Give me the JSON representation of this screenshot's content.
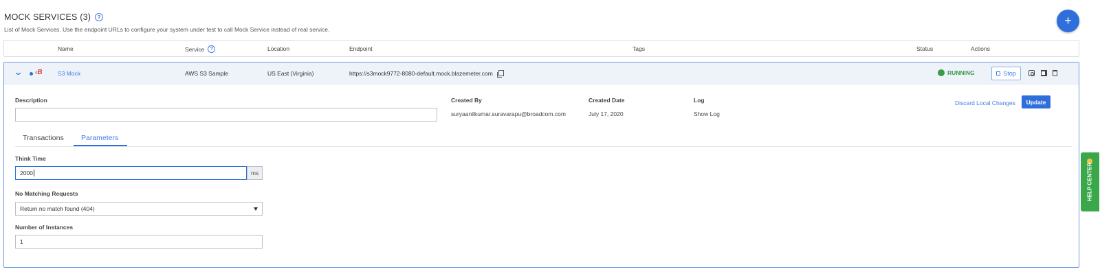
{
  "page": {
    "title": "MOCK SERVICES (3)",
    "subtitle": "List of Mock Services. Use the endpoint URLs to configure your system under test to call Mock Service instead of real service.",
    "add_label": "+"
  },
  "table": {
    "headers": {
      "name": "Name",
      "service": "Service",
      "location": "Location",
      "endpoint": "Endpoint",
      "tags": "Tags",
      "status": "Status",
      "actions": "Actions"
    }
  },
  "service": {
    "brand": "‹B",
    "name": "S3 Mock",
    "service": "AWS S3 Sample",
    "location": "US East (Virginia)",
    "endpoint": "https://s3mock9772-8080-default.mock.blazemeter.com",
    "status": "RUNNING",
    "status_color": "#3a9b4a",
    "stop_label": "Stop",
    "icons": [
      "chevron-down-icon",
      "copy-icon",
      "camera-icon",
      "spreadsheet-icon",
      "trash-icon"
    ]
  },
  "details": {
    "description_label": "Description",
    "description_value": "",
    "created_by_label": "Created By",
    "created_by": "suryaanilkumar.suravarapu@broadcom.com",
    "created_date_label": "Created Date",
    "created_date": "July 17, 2020",
    "log_label": "Log",
    "show_log": "Show Log",
    "discard_label": "Discard Local Changes",
    "update_label": "Update"
  },
  "tabs": [
    {
      "label": "Transactions",
      "active": false
    },
    {
      "label": "Parameters",
      "active": true
    }
  ],
  "parameters": {
    "think_time_label": "Think Time",
    "think_time_value": "2000",
    "think_time_unit": "ms",
    "no_match_label": "No Matching Requests",
    "no_match_value": "Return no match found (404)",
    "instances_label": "Number of Instances",
    "instances_value": "1"
  },
  "help_center": {
    "label": "HELP CENTER",
    "color": "#3aa84a"
  },
  "colors": {
    "accent": "#2f6fdc",
    "brand": "#d9453a"
  }
}
